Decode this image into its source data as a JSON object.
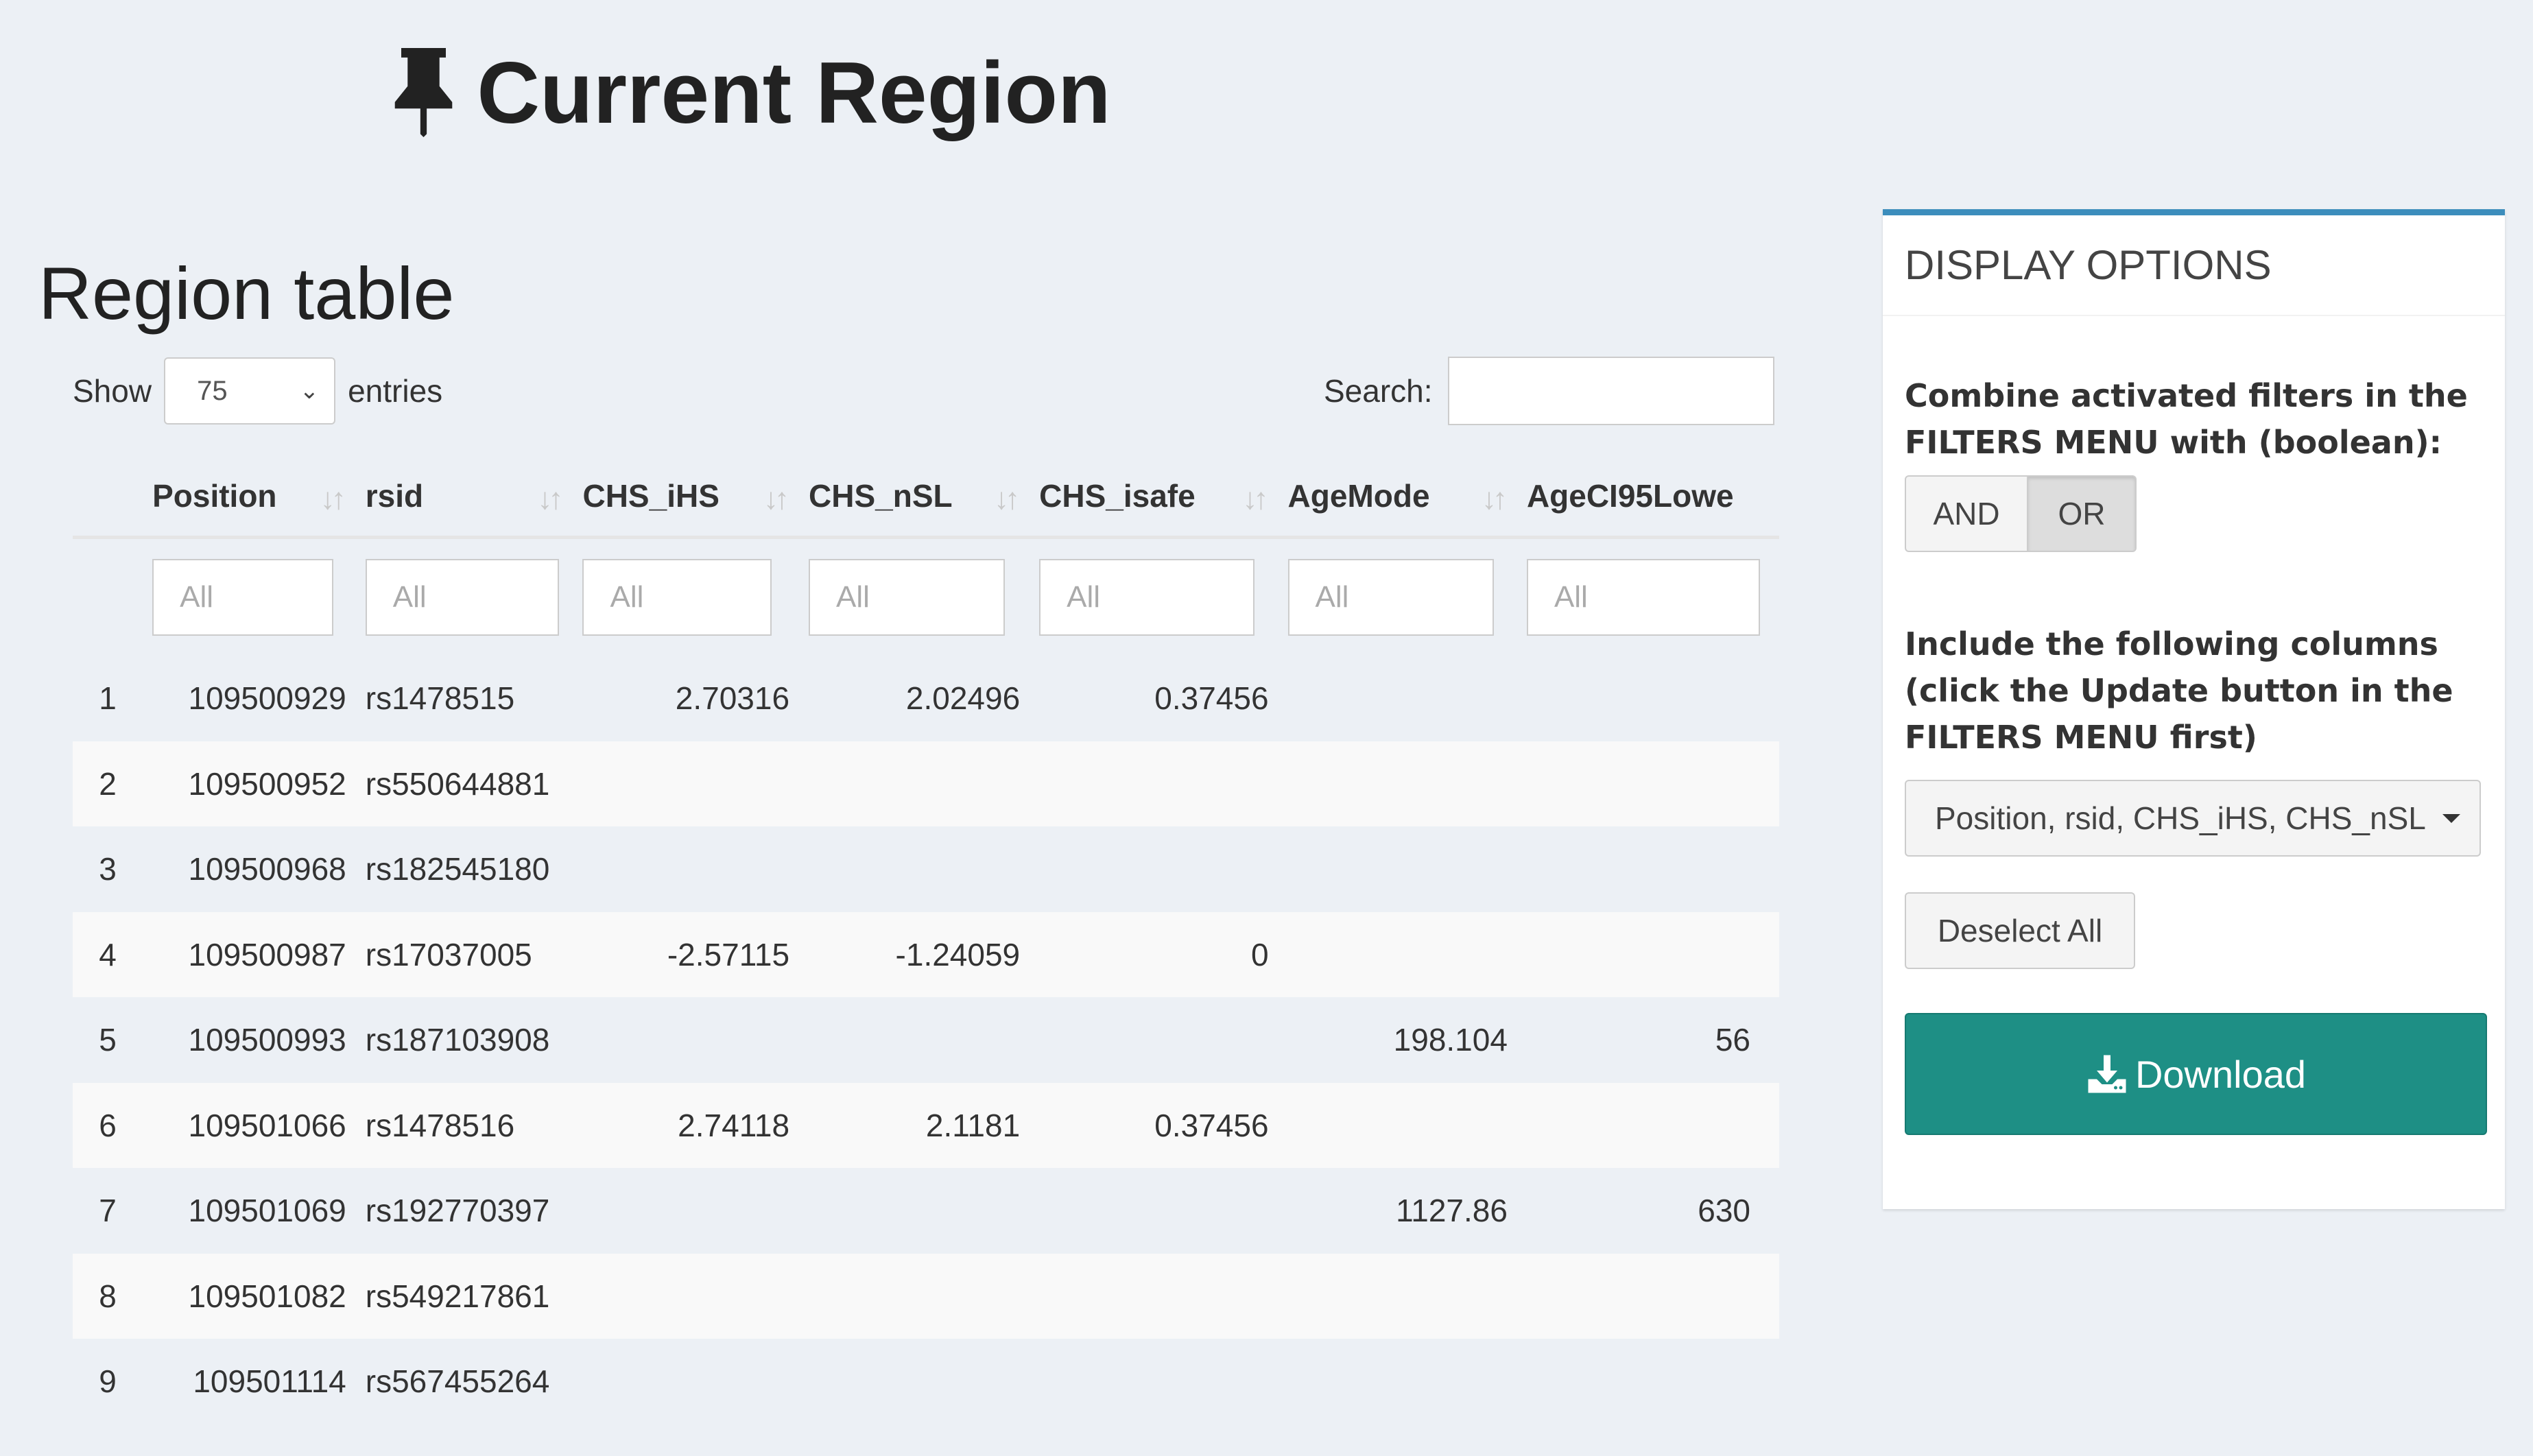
{
  "header": {
    "title": "Current Region",
    "icon": "pushpin-icon"
  },
  "section": {
    "title": "Region table"
  },
  "length": {
    "show_label": "Show",
    "selected": "75",
    "entries_label": "entries"
  },
  "search": {
    "label": "Search:",
    "value": ""
  },
  "table": {
    "columns": [
      "Position",
      "rsid",
      "CHS_iHS",
      "CHS_nSL",
      "CHS_isafe",
      "AgeMode",
      "AgeCI95Lowe"
    ],
    "filter_placeholder": "All",
    "rows": [
      {
        "idx": "1",
        "position": "109500929",
        "rsid": "rs1478515",
        "ihs": "2.70316",
        "nsl": "2.02496",
        "isafe": "0.37456",
        "agemode": "",
        "ageci": ""
      },
      {
        "idx": "2",
        "position": "109500952",
        "rsid": "rs550644881",
        "ihs": "",
        "nsl": "",
        "isafe": "",
        "agemode": "",
        "ageci": ""
      },
      {
        "idx": "3",
        "position": "109500968",
        "rsid": "rs182545180",
        "ihs": "",
        "nsl": "",
        "isafe": "",
        "agemode": "",
        "ageci": ""
      },
      {
        "idx": "4",
        "position": "109500987",
        "rsid": "rs17037005",
        "ihs": "-2.57115",
        "nsl": "-1.24059",
        "isafe": "0",
        "agemode": "",
        "ageci": ""
      },
      {
        "idx": "5",
        "position": "109500993",
        "rsid": "rs187103908",
        "ihs": "",
        "nsl": "",
        "isafe": "",
        "agemode": "198.104",
        "ageci": "56"
      },
      {
        "idx": "6",
        "position": "109501066",
        "rsid": "rs1478516",
        "ihs": "2.74118",
        "nsl": "2.1181",
        "isafe": "0.37456",
        "agemode": "",
        "ageci": ""
      },
      {
        "idx": "7",
        "position": "109501069",
        "rsid": "rs192770397",
        "ihs": "",
        "nsl": "",
        "isafe": "",
        "agemode": "1127.86",
        "ageci": "630"
      },
      {
        "idx": "8",
        "position": "109501082",
        "rsid": "rs549217861",
        "ihs": "",
        "nsl": "",
        "isafe": "",
        "agemode": "",
        "ageci": ""
      },
      {
        "idx": "9",
        "position": "109501114",
        "rsid": "rs567455264",
        "ihs": "",
        "nsl": "",
        "isafe": "",
        "agemode": "",
        "ageci": ""
      }
    ]
  },
  "panel": {
    "title": "DISPLAY OPTIONS",
    "combine_label": "Combine activated filters in the FILTERS MENU with (boolean):",
    "and_label": "AND",
    "or_label": "OR",
    "include_label": "Include the following columns (click the Update button in the FILTERS MENU first)",
    "columns_selected": "Position, rsid, CHS_iHS, CHS_nSL",
    "deselect_label": "Deselect All",
    "download_label": "Download",
    "accent_color": "#3c8dbc",
    "download_color": "#1e8f85"
  }
}
